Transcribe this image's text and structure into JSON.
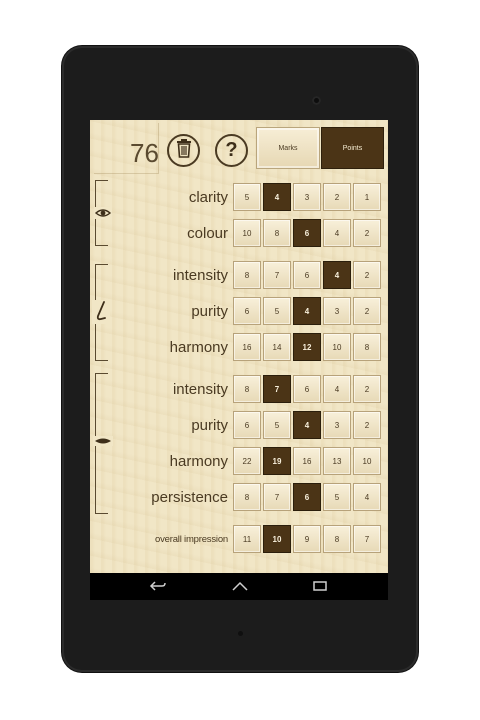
{
  "score": "76",
  "mode": {
    "marks_label": "Marks",
    "points_label": "Points",
    "selected": "Points"
  },
  "icons": {
    "delete": "trash-icon",
    "help": "question-mark-icon",
    "sight": "eye-icon",
    "smell": "nose-icon",
    "taste": "mouth-icon"
  },
  "colors": {
    "selected": "#4b3416",
    "wood": "#f1e6c6",
    "text": "#4a3a22"
  },
  "rows": [
    {
      "label": "clarity",
      "options": [
        "5",
        "4",
        "3",
        "2",
        "1"
      ],
      "selected": 1
    },
    {
      "label": "colour",
      "options": [
        "10",
        "8",
        "6",
        "4",
        "2"
      ],
      "selected": 2
    },
    {
      "label": "intensity",
      "options": [
        "8",
        "7",
        "6",
        "4",
        "2"
      ],
      "selected": 3
    },
    {
      "label": "purity",
      "options": [
        "6",
        "5",
        "4",
        "3",
        "2"
      ],
      "selected": 2
    },
    {
      "label": "harmony",
      "options": [
        "16",
        "14",
        "12",
        "10",
        "8"
      ],
      "selected": 2
    },
    {
      "label": "intensity",
      "options": [
        "8",
        "7",
        "6",
        "4",
        "2"
      ],
      "selected": 1
    },
    {
      "label": "purity",
      "options": [
        "6",
        "5",
        "4",
        "3",
        "2"
      ],
      "selected": 2
    },
    {
      "label": "harmony",
      "options": [
        "22",
        "19",
        "16",
        "13",
        "10"
      ],
      "selected": 1
    },
    {
      "label": "persistence",
      "options": [
        "8",
        "7",
        "6",
        "5",
        "4"
      ],
      "selected": 2
    },
    {
      "label": "overall impression",
      "options": [
        "11",
        "10",
        "9",
        "8",
        "7"
      ],
      "selected": 1
    }
  ]
}
